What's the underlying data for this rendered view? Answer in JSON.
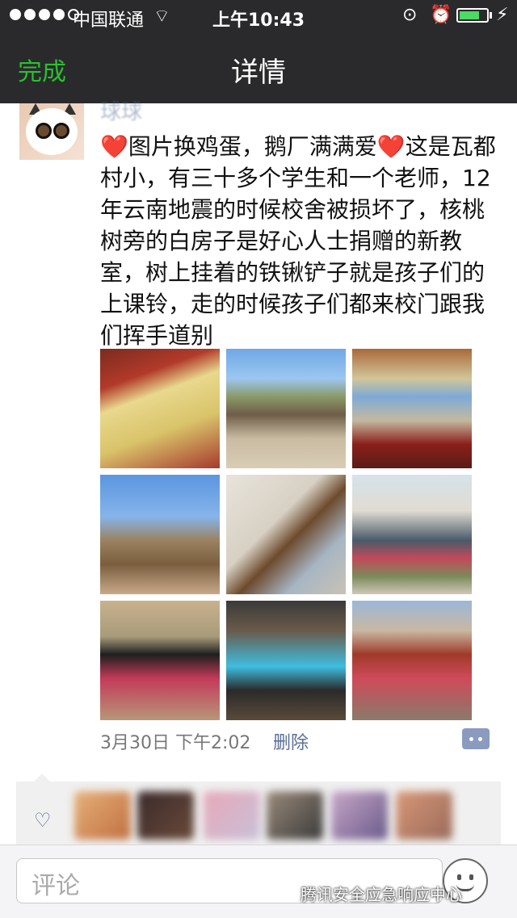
{
  "status_bar": {
    "carrier": "中国联通",
    "time": "上午10:43"
  },
  "nav": {
    "done_label": "完成",
    "title": "详情"
  },
  "post": {
    "username": "球球",
    "text": "❤️图片换鸡蛋，鹅厂满满爱❤️这是瓦都村小，有三十多个学生和一个老师，12年云南地震的时候校舍被损坏了，核桃树旁的白房子是好心人士捐赠的新教室，树上挂着的铁锹铲子就是孩子们的上课铃，走的时候孩子们都来校门跟我们挥手道别",
    "date": "3月30日 下午2:02",
    "delete_label": "删除"
  },
  "input": {
    "placeholder": "评论"
  },
  "watermark": "腾讯安全应急响应中心",
  "colors": {
    "nav_bg": "#2a2a2c",
    "done_green": "#29c12e",
    "link_blue": "#5a6e95"
  }
}
